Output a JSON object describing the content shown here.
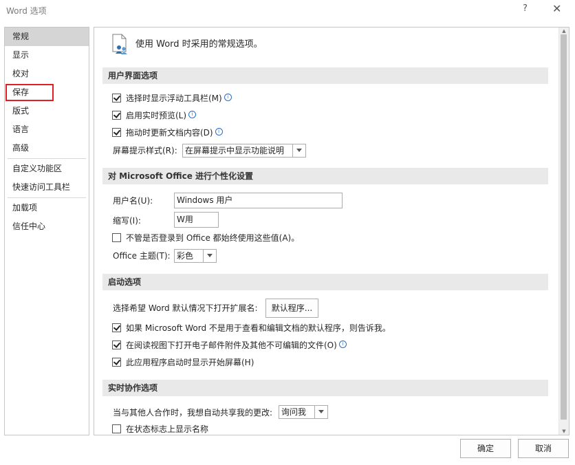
{
  "window": {
    "title": "Word 选项",
    "help_label": "?",
    "close_label": "✕"
  },
  "nav": {
    "items": [
      {
        "label": "常规"
      },
      {
        "label": "显示"
      },
      {
        "label": "校对"
      },
      {
        "label": "保存"
      },
      {
        "label": "版式"
      },
      {
        "label": "语言"
      },
      {
        "label": "高级"
      },
      {
        "label": "自定义功能区"
      },
      {
        "label": "快速访问工具栏"
      },
      {
        "label": "加载项"
      },
      {
        "label": "信任中心"
      }
    ]
  },
  "content": {
    "header": "使用 Word 时采用的常规选项。",
    "ui_options": {
      "title": "用户界面选项",
      "checkboxes": [
        {
          "label": "选择时显示浮动工具栏(M)",
          "checked": true,
          "info": "i"
        },
        {
          "label": "启用实时预览(L)",
          "checked": true,
          "info": "i"
        },
        {
          "label": "拖动时更新文档内容(D)",
          "checked": true,
          "info": "i"
        }
      ],
      "screentip_label": "屏幕提示样式(R):",
      "screentip_value": "在屏幕提示中显示功能说明"
    },
    "personalize": {
      "title": "对 Microsoft Office 进行个性化设置",
      "username_label": "用户名(U):",
      "username_value": "Windows 用户",
      "initials_label": "缩写(I):",
      "initials_value": "W用",
      "always_use_label": "不管是否登录到 Office 都始终使用这些值(A)。",
      "always_use_checked": false,
      "theme_label": "Office 主题(T):",
      "theme_value": "彩色"
    },
    "startup": {
      "title": "启动选项",
      "default_ext_label": "选择希望 Word 默认情况下打开扩展名:",
      "default_button": "默认程序...",
      "checkboxes": [
        {
          "label": "如果 Microsoft Word 不是用于查看和编辑文档的默认程序，则告诉我。",
          "checked": true
        },
        {
          "label": "在阅读视图下打开电子邮件附件及其他不可编辑的文件(O)",
          "checked": true,
          "info": "i"
        },
        {
          "label": "此应用程序启动时显示开始屏幕(H)",
          "checked": true
        }
      ]
    },
    "coauthor": {
      "title": "实时协作选项",
      "share_label": "当与其他人合作时，我想自动共享我的更改:",
      "share_value": "询问我",
      "show_names_label": "在状态标志上显示名称",
      "show_names_checked": false
    }
  },
  "footer": {
    "ok_label": "确定",
    "cancel_label": "取消"
  },
  "colors": {
    "highlight_box": "#e02020",
    "nav_selected": "#d5d5d5",
    "section_bg": "#e9e9e9"
  }
}
